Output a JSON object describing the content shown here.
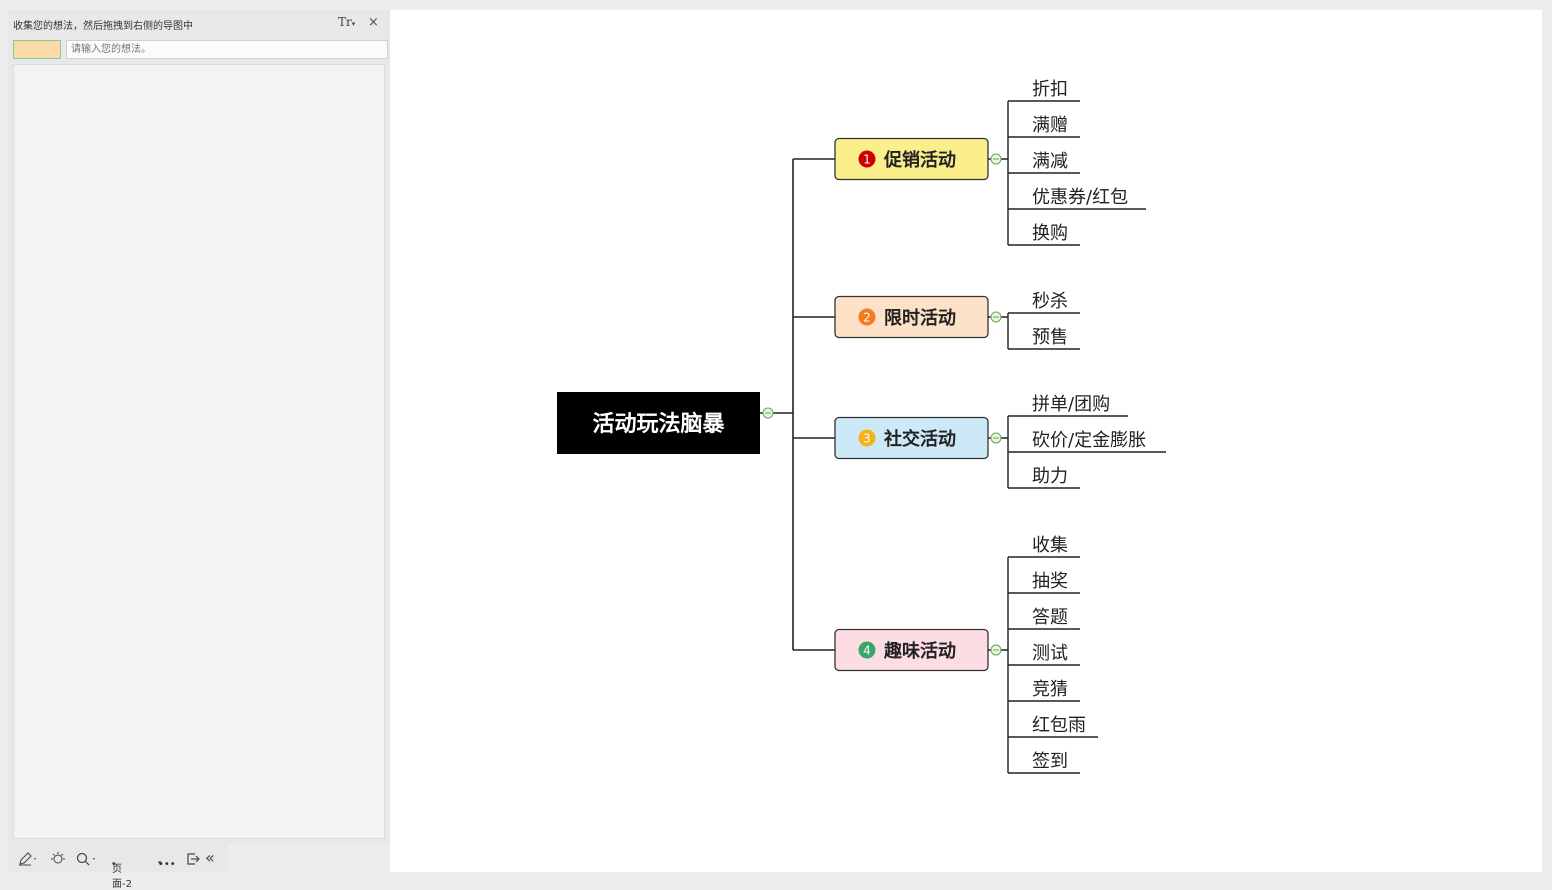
{
  "panel": {
    "title": "收集您的想法，然后拖拽到右侧的导图中",
    "font_button": "Tr",
    "font_button_arrow": "▾",
    "close": "×",
    "input_placeholder": "请输入您的想法。",
    "swatch_color": "#fcd9a8"
  },
  "footer": {
    "page_label": "页面-2",
    "more": "•••",
    "dropdown_arrow": "▾",
    "collapse": "«"
  },
  "mindmap": {
    "root": {
      "label": "活动玩法脑暴",
      "color": "#000000",
      "text_color": "#ffffff"
    },
    "branches": [
      {
        "number": "1",
        "label": "促销活动",
        "fill": "#fbef8c",
        "badge_color": "#cc0000",
        "children": [
          "折扣",
          "满赠",
          "满减",
          "优惠券/红包",
          "换购"
        ]
      },
      {
        "number": "2",
        "label": "限时活动",
        "fill": "#fde2c7",
        "badge_color": "#f47b20",
        "children": [
          "秒杀",
          "预售"
        ]
      },
      {
        "number": "3",
        "label": "社交活动",
        "fill": "#cde8f6",
        "badge_color": "#f6b21c",
        "children": [
          "拼单/团购",
          "砍价/定金膨胀",
          "助力"
        ]
      },
      {
        "number": "4",
        "label": "趣味活动",
        "fill": "#fcdde3",
        "badge_color": "#3aa56a",
        "children": [
          "收集",
          "抽奖",
          "答题",
          "测试",
          "竞猜",
          "红包雨",
          "签到"
        ]
      }
    ]
  }
}
